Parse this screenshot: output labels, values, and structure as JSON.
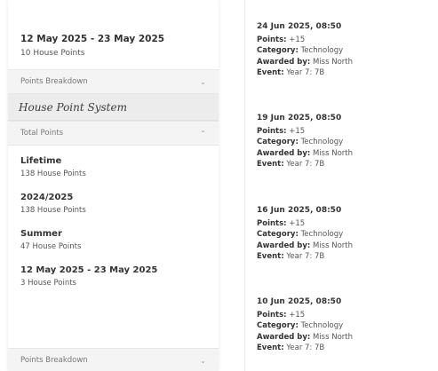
{
  "left": {
    "top_card": {
      "date_range": "12 May 2025 - 23 May 2025",
      "points": "10 House Points"
    },
    "breakdown_top_label": "Points Breakdown",
    "section_title": "House Point System",
    "total_points_label": "Total Points",
    "totals": [
      {
        "title": "Lifetime",
        "value": "138 House Points"
      },
      {
        "title": "2024/2025",
        "value": "138 House Points"
      },
      {
        "title": "Summer",
        "value": "47 House Points"
      },
      {
        "title": "12 May 2025 - 23 May 2025",
        "value": "3 House Points"
      }
    ],
    "breakdown_bottom_label": "Points Breakdown"
  },
  "right": {
    "entries": [
      {
        "date": "24 Jun 2025, 08:50",
        "points_label": "Points:",
        "points": "+15",
        "category_label": "Category:",
        "category": "Technology",
        "awarded_label": "Awarded by:",
        "awarded": "Miss North",
        "event_label": "Event:",
        "event": "Year 7: 7B"
      },
      {
        "date": "19 Jun 2025, 08:50",
        "points_label": "Points:",
        "points": "+15",
        "category_label": "Category:",
        "category": "Technology",
        "awarded_label": "Awarded by:",
        "awarded": "Miss North",
        "event_label": "Event:",
        "event": "Year 7: 7B"
      },
      {
        "date": "16 Jun 2025, 08:50",
        "points_label": "Points:",
        "points": "+15",
        "category_label": "Category:",
        "category": "Technology",
        "awarded_label": "Awarded by:",
        "awarded": "Miss North",
        "event_label": "Event:",
        "event": "Year 7: 7B"
      },
      {
        "date": "10 Jun 2025, 08:50",
        "points_label": "Points:",
        "points": "+15",
        "category_label": "Category:",
        "category": "Technology",
        "awarded_label": "Awarded by:",
        "awarded": "Miss North",
        "event_label": "Event:",
        "event": "Year 7: 7B"
      }
    ]
  }
}
